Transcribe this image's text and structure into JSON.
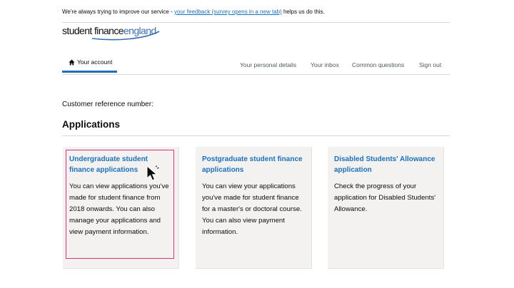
{
  "banner": {
    "prefix": "We're always trying to improve our service - ",
    "link_text": "your feedback (survey opens in a new tab)",
    "suffix": " helps us do this."
  },
  "logo": {
    "part1": "student finance",
    "part2": "england"
  },
  "nav": {
    "home_label": "Your account",
    "links": [
      "Your personal details",
      "Your inbox",
      "Common questions",
      "Sign out"
    ]
  },
  "main": {
    "customer_ref_label": "Customer reference number:",
    "heading": "Applications",
    "cards": [
      {
        "title": "Undergraduate student finance applications",
        "text": "You can view applications you've made for student finance from 2018 onwards. You can also manage your applications and view payment information."
      },
      {
        "title": "Postgraduate student finance applications",
        "text": "You can view your applications you've made for student finance for a master's or doctoral course. You can also view payment information."
      },
      {
        "title": "Disabled Students' Allowance application",
        "text": "Check the progress of your application for Disabled Students' Allowance."
      }
    ]
  },
  "colors": {
    "link": "#1d70b8",
    "highlight": "#d6367a",
    "card_bg": "#f3f2f1"
  },
  "icons": {
    "home": "home-icon",
    "cursor": "mouse-pointer-icon"
  }
}
